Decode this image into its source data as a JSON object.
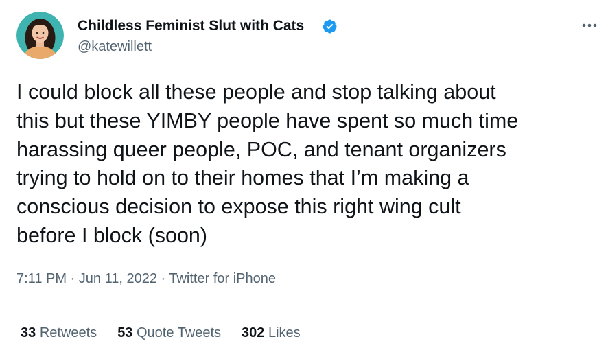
{
  "author": {
    "display_name": "Childless Feminist Slut with Cats",
    "handle": "@katewillett",
    "verified": true,
    "avatar_icon": "profile-photo",
    "verified_icon": "verified-badge-icon"
  },
  "more_icon": "more-options-icon",
  "tweet": {
    "text": "I could block all these people and stop talking about\nthis but these YIMBY people have spent so much time\nharassing queer people, POC, and tenant organizers\ntrying to hold on to their homes that I’m making a\nconscious decision to expose this right wing cult\nbefore I block (soon)"
  },
  "meta": {
    "time": "7:11 PM",
    "separator": " · ",
    "date": "Jun 11, 2022",
    "source": "Twitter for iPhone"
  },
  "stats": {
    "retweets_count": "33",
    "retweets_label": "Retweets",
    "quotes_count": "53",
    "quotes_label": "Quote Tweets",
    "likes_count": "302",
    "likes_label": "Likes"
  },
  "colors": {
    "text_primary": "#0f1419",
    "text_secondary": "#536471",
    "verified_blue": "#1d9bf0",
    "divider": "#eff3f4"
  }
}
